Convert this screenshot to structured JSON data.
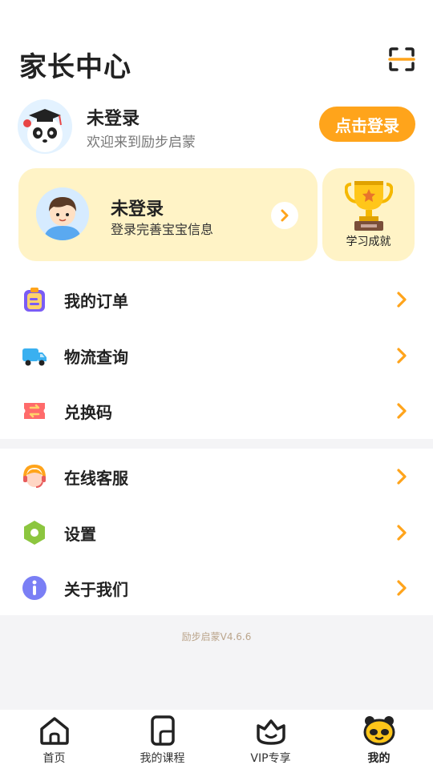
{
  "header": {
    "title": "家长中心",
    "scan_icon": "scan-icon"
  },
  "user": {
    "name": "未登录",
    "subtitle": "欢迎来到励步启蒙",
    "login_label": "点击登录",
    "avatar_icon": "panda-avatar-icon"
  },
  "baby": {
    "title": "未登录",
    "subtitle": "登录完善宝宝信息",
    "avatar_icon": "boy-avatar-icon"
  },
  "achievement": {
    "label": "学习成就",
    "icon": "trophy-icon"
  },
  "menu_group_1": [
    {
      "label": "我的订单",
      "icon": "clipboard-icon",
      "color": "#7a5cf5"
    },
    {
      "label": "物流查询",
      "icon": "truck-icon",
      "color": "#3ab0f0"
    },
    {
      "label": "兑换码",
      "icon": "coupon-icon",
      "color": "#ff6b6b"
    }
  ],
  "menu_group_2": [
    {
      "label": "在线客服",
      "icon": "customer-service-icon",
      "color": "#ffa41b"
    },
    {
      "label": "设置",
      "icon": "settings-icon",
      "color": "#8cc63f"
    },
    {
      "label": "关于我们",
      "icon": "info-icon",
      "color": "#7a7ff5"
    }
  ],
  "version": "励步启蒙V4.6.6",
  "tabs": [
    {
      "label": "首页",
      "icon": "home-icon"
    },
    {
      "label": "我的课程",
      "icon": "course-icon"
    },
    {
      "label": "VIP专享",
      "icon": "vip-crown-icon"
    },
    {
      "label": "我的",
      "icon": "panda-face-icon",
      "active": true
    }
  ],
  "colors": {
    "accent": "#ffa41b",
    "card_bg": "#fff3c6",
    "page_bg": "#f4f4f6"
  }
}
